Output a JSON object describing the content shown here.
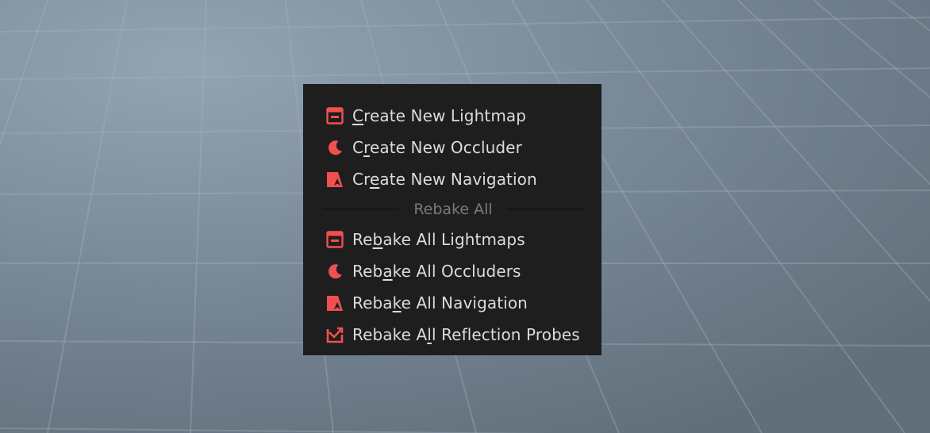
{
  "colors": {
    "accent": "#f0504f",
    "menu_bg": "#1e1e1e",
    "text": "#dcdcdc",
    "separator_text": "#7a7a7a"
  },
  "menu": {
    "create_items": [
      {
        "label": "Create New Lightmap",
        "underline_index": 0,
        "icon": "lightmap-icon"
      },
      {
        "label": "Create New Occluder",
        "underline_index": 1,
        "icon": "occluder-moon-icon"
      },
      {
        "label": "Create New Navigation",
        "underline_index": 2,
        "icon": "navigation-icon"
      }
    ],
    "separator_label": "Rebake All",
    "rebake_items": [
      {
        "label": "Rebake All Lightmaps",
        "underline_index": 2,
        "icon": "lightmap-icon"
      },
      {
        "label": "Rebake All Occluders",
        "underline_index": 3,
        "icon": "occluder-moon-icon"
      },
      {
        "label": "Rebake All Navigation",
        "underline_index": 4,
        "icon": "navigation-icon"
      },
      {
        "label": "Rebake All Reflection Probes",
        "underline_index": 8,
        "icon": "reflection-probe-icon"
      }
    ]
  }
}
